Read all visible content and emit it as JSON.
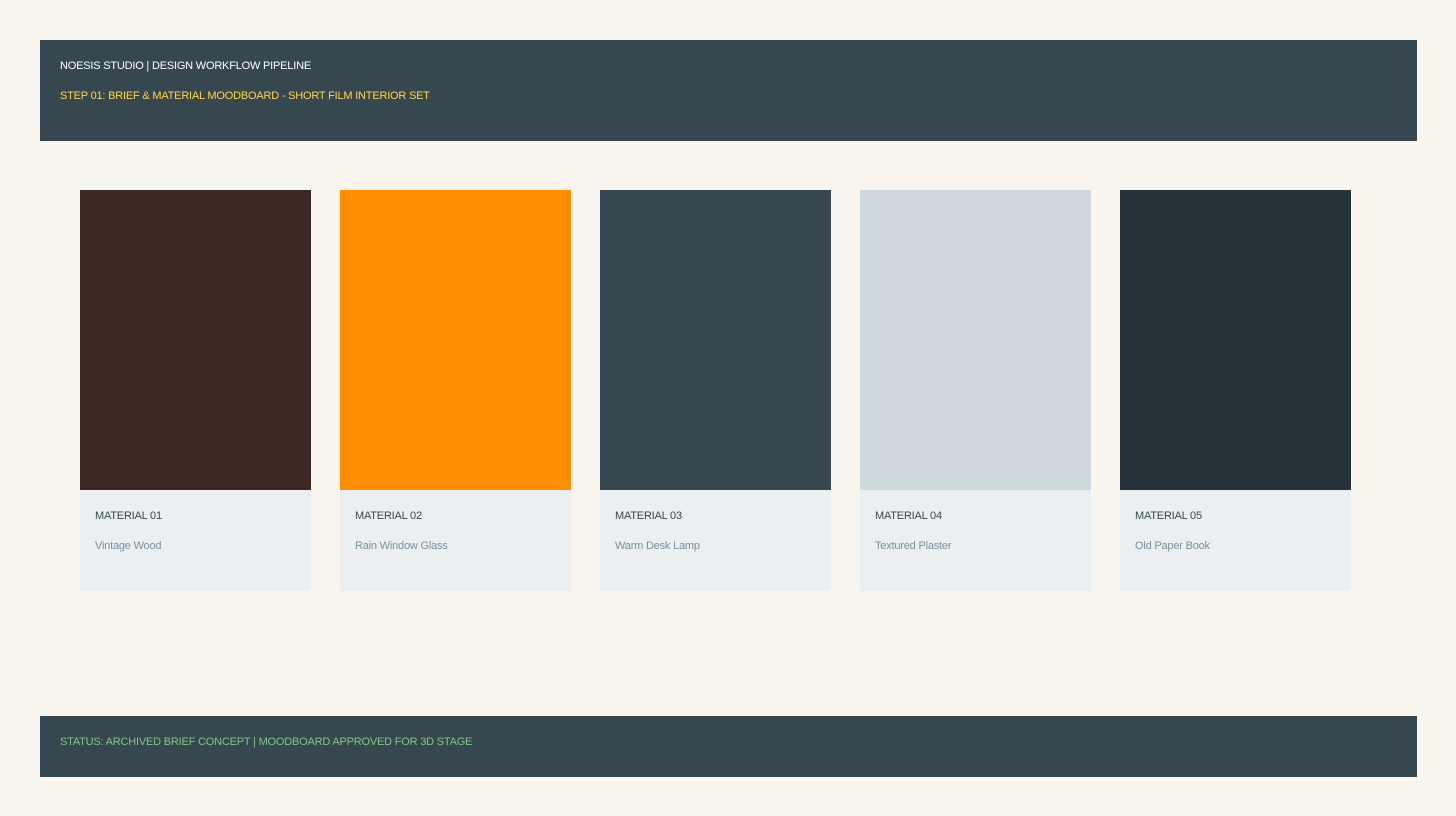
{
  "header": {
    "title": "NOESIS STUDIO | DESIGN WORKFLOW PIPELINE",
    "step": "STEP 01: BRIEF & MATERIAL MOODBOARD - SHORT FILM INTERIOR SET"
  },
  "materials": [
    {
      "label": "MATERIAL 01",
      "name": "Vintage Wood",
      "color": "#3e2723"
    },
    {
      "label": "MATERIAL 02",
      "name": "Rain Window Glass",
      "color": "#ff8f00"
    },
    {
      "label": "MATERIAL 03",
      "name": "Warm Desk Lamp",
      "color": "#37474f"
    },
    {
      "label": "MATERIAL 04",
      "name": "Textured Plaster",
      "color": "#cfd8dc"
    },
    {
      "label": "MATERIAL 05",
      "name": "Old Paper Book",
      "color": "#263238"
    }
  ],
  "footer": {
    "status": "STATUS: ARCHIVED BRIEF CONCEPT | MOODBOARD APPROVED FOR 3D STAGE"
  },
  "colors": {
    "page_background": "#f8f5ef",
    "bar_background": "#37474f",
    "step_accent": "#ffd54f",
    "status_accent": "#81c784",
    "card_background": "#eceff1"
  }
}
